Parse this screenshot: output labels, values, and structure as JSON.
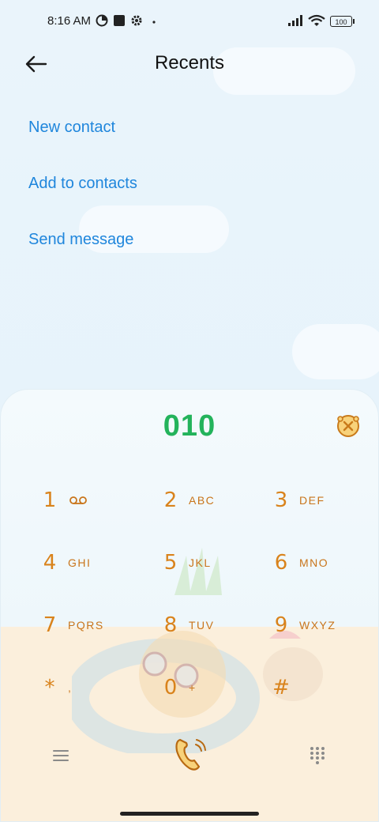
{
  "status_bar": {
    "time": "8:16 AM",
    "battery": "100",
    "icons": [
      "data-saver-icon",
      "square-app-icon",
      "settings-icon",
      "dot-icon",
      "signal-icon",
      "wifi-icon",
      "battery-icon"
    ]
  },
  "header": {
    "title": "Recents",
    "back_icon": "back-arrow-icon"
  },
  "actions": {
    "new_contact": "New contact",
    "add_to_contacts": "Add to contacts",
    "send_message": "Send message"
  },
  "dialer": {
    "number": "010",
    "backspace_icon": "backspace-icon",
    "keys": [
      {
        "digit": "1",
        "letters": ""
      },
      {
        "digit": "2",
        "letters": "ABC"
      },
      {
        "digit": "3",
        "letters": "DEF"
      },
      {
        "digit": "4",
        "letters": "GHI"
      },
      {
        "digit": "5",
        "letters": "JKL"
      },
      {
        "digit": "6",
        "letters": "MNO"
      },
      {
        "digit": "7",
        "letters": "PQRS"
      },
      {
        "digit": "8",
        "letters": "TUV"
      },
      {
        "digit": "9",
        "letters": "WXYZ"
      },
      {
        "digit": "*",
        "letters": ","
      },
      {
        "digit": "0",
        "letters": "+"
      },
      {
        "digit": "#",
        "letters": ""
      }
    ]
  },
  "bottom_bar": {
    "menu_icon": "menu-icon",
    "call_icon": "call-icon",
    "keypad_icon": "keypad-icon"
  },
  "colors": {
    "accent_link": "#1f86dc",
    "number": "#23b35b",
    "key": "#d9831c"
  }
}
